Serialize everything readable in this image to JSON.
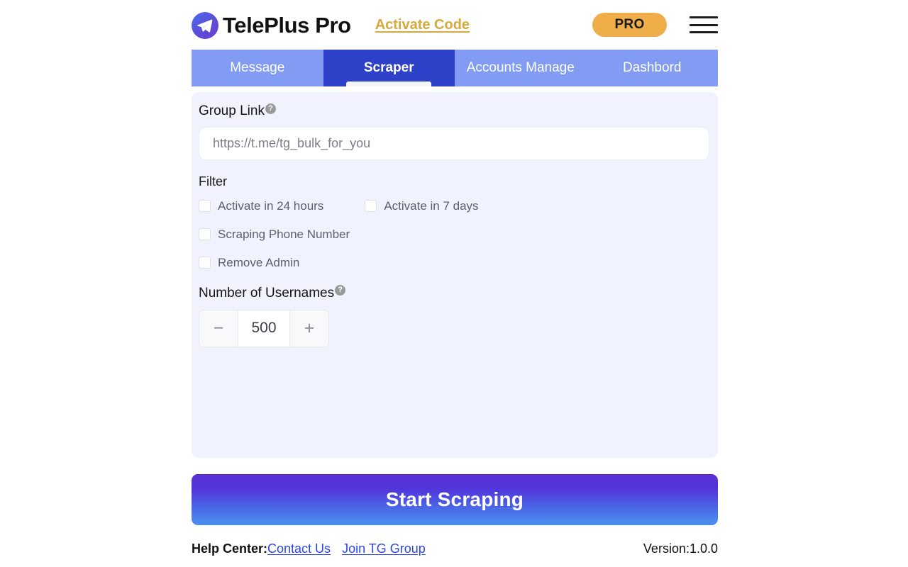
{
  "header": {
    "app_title": "TelePlus Pro",
    "logo_icon": "telegram-plane-icon",
    "activate_link": "Activate Code",
    "pro_badge": "PRO",
    "menu_icon": "hamburger-menu-icon",
    "colors": {
      "brand_gold": "#d6a93c",
      "pro_amber": "#efae4a",
      "logo_gradient_start": "#4a6cf0",
      "logo_gradient_end": "#6b3fd0"
    }
  },
  "tabs": {
    "active_index": 1,
    "items": [
      {
        "label": "Message"
      },
      {
        "label": "Scraper"
      },
      {
        "label": "Accounts Manage"
      },
      {
        "label": "Dashbord"
      }
    ],
    "colors": {
      "inactive_bg": "#819cf2",
      "active_bg": "#2e41c9",
      "text": "#ffffff"
    }
  },
  "panel": {
    "background": "#f0f3fd",
    "group_link": {
      "label": "Group Link",
      "help_icon": "question-mark-icon",
      "help_glyph": "?",
      "value": "",
      "placeholder": "https://t.me/tg_bulk_for_you"
    },
    "filter": {
      "label": "Filter",
      "options": [
        {
          "label": "Activate in 24 hours",
          "checked": false
        },
        {
          "label": "Activate in 7 days",
          "checked": false
        },
        {
          "label": "Scraping Phone Number",
          "checked": false
        },
        {
          "label": "Remove Admin",
          "checked": false
        }
      ]
    },
    "usernames": {
      "label": "Number of Usernames",
      "help_icon": "question-mark-icon",
      "help_glyph": "?",
      "value": "500",
      "decrement_glyph": "−",
      "increment_glyph": "+"
    }
  },
  "action": {
    "start_label": "Start Scraping",
    "gradient_top": "#5a2ed4",
    "gradient_bottom": "#4b90ef"
  },
  "footer": {
    "help_center_label": "Help Center:",
    "contact_link": "Contact Us",
    "tg_group_link": "Join TG Group",
    "version": "Version:1.0.0",
    "link_color": "#2b45e8"
  }
}
